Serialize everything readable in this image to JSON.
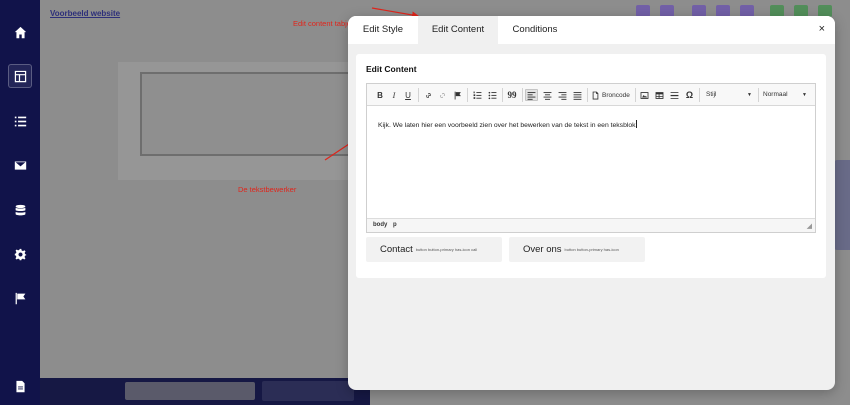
{
  "background": {
    "link_text": "Voorbeeld website"
  },
  "sidebar": {
    "items": [
      {
        "icon": "home-icon"
      },
      {
        "icon": "layout-icon"
      },
      {
        "icon": "list-icon"
      },
      {
        "icon": "mail-icon"
      },
      {
        "icon": "database-icon"
      },
      {
        "icon": "gear-icon"
      },
      {
        "icon": "flag-icon"
      },
      {
        "icon": "file-icon"
      }
    ]
  },
  "annotations": {
    "tab_note": "Edit content tabje",
    "editor_note": "De tekstbewerker"
  },
  "modal": {
    "tabs": [
      {
        "label": "Edit Style"
      },
      {
        "label": "Edit Content"
      },
      {
        "label": "Conditions"
      }
    ],
    "active_tab": "Edit Content",
    "close_label": "×",
    "card_title": "Edit Content",
    "editor": {
      "toolbar": {
        "bold": "B",
        "italic": "I",
        "underline": "U",
        "quote": "99",
        "source_label": "Broncode",
        "omega": "Ω",
        "style_select": "Stijl",
        "format_select": "Normaal"
      },
      "body_text": "Kijk. We laten hier een voorbeeld zien over het bewerken van de tekst in een teksblok",
      "path": [
        "body",
        "p"
      ]
    },
    "buttons": [
      {
        "label": "Contact",
        "class_text": "button button-primary has-icon call"
      },
      {
        "label": "Over ons",
        "class_text": "button button-primary has-icon"
      }
    ]
  },
  "colors": {
    "sidebar": "#11134a",
    "annotation": "#e0251b",
    "modal_bg": "#f0f0f0"
  }
}
